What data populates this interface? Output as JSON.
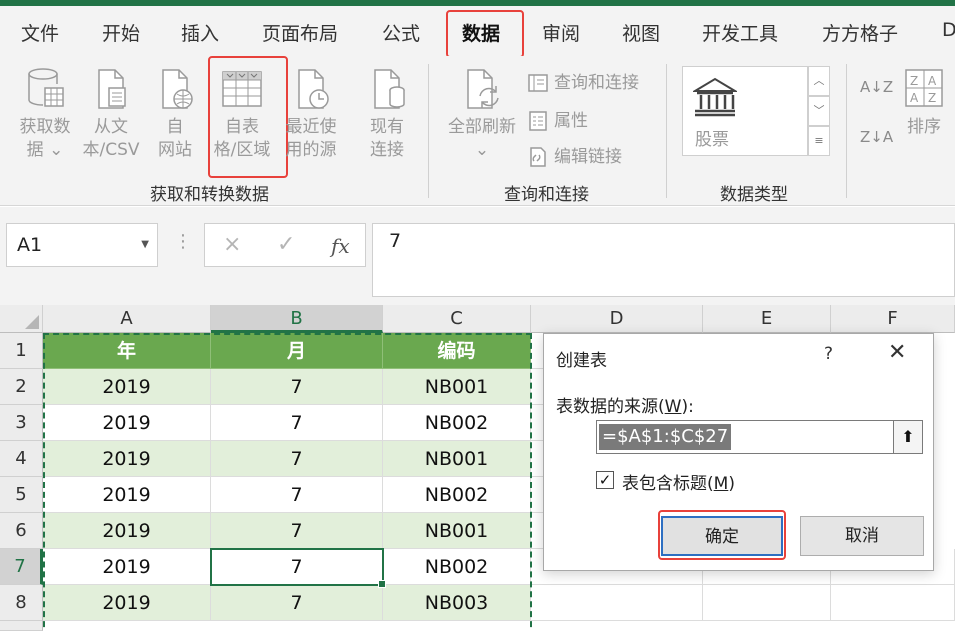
{
  "ribbon_tabs": [
    "文件",
    "开始",
    "插入",
    "页面布局",
    "公式",
    "数据",
    "审阅",
    "视图",
    "开发工具",
    "方方格子",
    "D"
  ],
  "active_tab": "数据",
  "groups": {
    "get_transform": {
      "label": "获取和转换数据",
      "buttons": [
        {
          "line1": "获取数",
          "line2": "据 ⌄"
        },
        {
          "line1": "从文",
          "line2": "本/CSV"
        },
        {
          "line1": "自",
          "line2": "网站"
        },
        {
          "line1": "自表",
          "line2": "格/区域"
        },
        {
          "line1": "最近使",
          "line2": "用的源"
        },
        {
          "line1": "现有",
          "line2": "连接"
        }
      ]
    },
    "queries": {
      "label": "查询和连接",
      "refresh_line1": "全部刷新",
      "refresh_line2": "⌄",
      "small": [
        "查询和连接",
        "属性",
        "编辑链接"
      ]
    },
    "data_types": {
      "label": "数据类型",
      "gallery_item": "股票"
    },
    "sort": {
      "sort_label": "排序",
      "az": "A↓Z",
      "za": "Z↓A"
    }
  },
  "formula_bar": {
    "name_box": "A1",
    "fx": "fx",
    "cancel_icon": "×",
    "enter_icon": "✓",
    "value": "7"
  },
  "sheet": {
    "columns": [
      "A",
      "B",
      "C",
      "D",
      "E",
      "F"
    ],
    "rows": [
      "1",
      "2",
      "3",
      "4",
      "5",
      "6",
      "7",
      "8"
    ],
    "header": [
      "年",
      "月",
      "编码"
    ],
    "data": [
      [
        "2019",
        "7",
        "NB001"
      ],
      [
        "2019",
        "7",
        "NB002"
      ],
      [
        "2019",
        "7",
        "NB001"
      ],
      [
        "2019",
        "7",
        "NB002"
      ],
      [
        "2019",
        "7",
        "NB001"
      ],
      [
        "2019",
        "7",
        "NB002"
      ],
      [
        "2019",
        "7",
        "NB003"
      ]
    ]
  },
  "dialog": {
    "title": "创建表",
    "help": "?",
    "close": "✕",
    "source_label_pre": "表数据的来源(",
    "source_label_key": "W",
    "source_label_post": "):",
    "range": "=$A$1:$C$27",
    "collapse_icon": "⬆",
    "checkbox_checked": true,
    "checkbox_mark": "✓",
    "checkbox_label_pre": "表包含标题(",
    "checkbox_label_key": "M",
    "checkbox_label_post": ")",
    "ok": "确定",
    "cancel": "取消"
  },
  "colors": {
    "excel_green": "#217346",
    "header_green": "#6aa84f",
    "band_green": "#e2efda",
    "highlight_red": "#e8413b"
  }
}
